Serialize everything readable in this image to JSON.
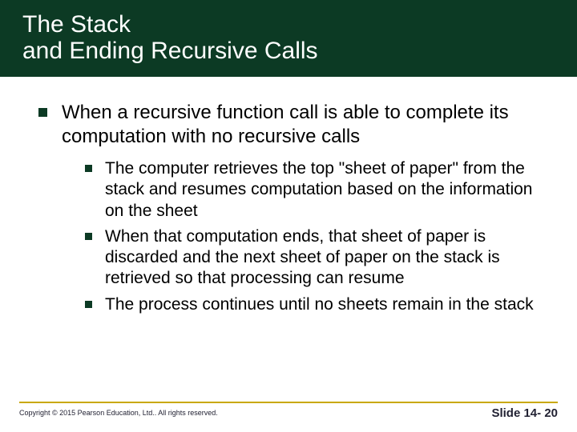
{
  "title": {
    "line1": "The Stack",
    "line2": "and Ending Recursive Calls"
  },
  "bullets": {
    "lvl1": "When a recursive function call is able to complete its computation with no recursive calls",
    "lvl2": [
      "The computer retrieves the top \"sheet of paper\" from the stack and resumes computation based on the information on the sheet",
      "When that computation ends, that sheet of paper is discarded and the next sheet of paper on the stack is retrieved so that processing can resume",
      "The process continues until no sheets remain in the stack"
    ]
  },
  "footer": {
    "copyright": "Copyright © 2015 Pearson Education, Ltd.. All rights reserved.",
    "slidenum": "Slide 14- 20"
  }
}
